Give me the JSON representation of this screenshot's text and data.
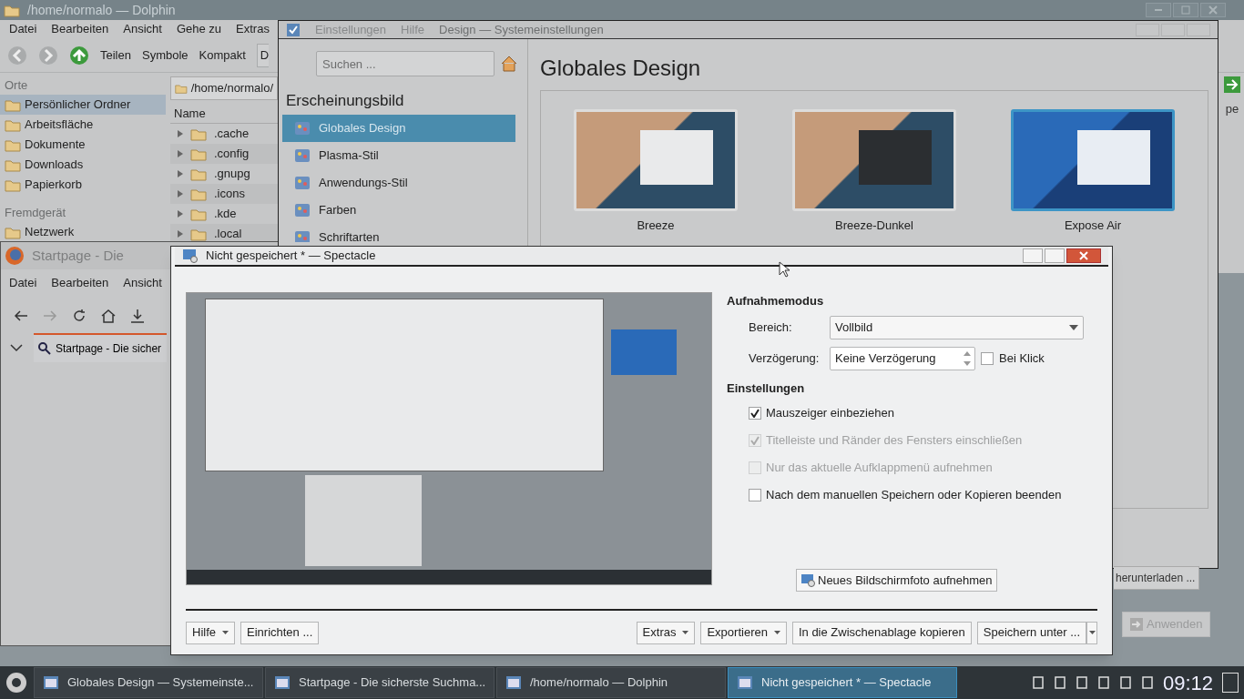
{
  "dolphin": {
    "title": "/home/normalo — Dolphin",
    "menu": [
      "Datei",
      "Bearbeiten",
      "Ansicht",
      "Gehe zu",
      "Extras"
    ],
    "toolbar": [
      "Teilen",
      "Symbole",
      "Kompakt",
      "D"
    ],
    "places_heading": "Orte",
    "places": [
      {
        "label": "Persönlicher Ordner",
        "selected": true
      },
      {
        "label": "Arbeitsfläche",
        "selected": false
      },
      {
        "label": "Dokumente",
        "selected": false
      },
      {
        "label": "Downloads",
        "selected": false
      },
      {
        "label": "Papierkorb",
        "selected": false
      }
    ],
    "remote_heading": "Fremdgerät",
    "remote": [
      "Netzwerk"
    ],
    "path": "/home/normalo/",
    "column": "Name",
    "column_fragment": "pe",
    "folders": [
      ".cache",
      ".config",
      ".gnupg",
      ".icons",
      ".kde",
      ".local"
    ]
  },
  "settings": {
    "menu": [
      "Einstellungen",
      "Hilfe"
    ],
    "title": "Design — Systemeinstellungen",
    "search_placeholder": "Suchen ...",
    "section": "Erscheinungsbild",
    "items": [
      {
        "label": "Globales Design",
        "selected": true
      },
      {
        "label": "Plasma-Stil",
        "selected": false
      },
      {
        "label": "Anwendungs-Stil",
        "selected": false
      },
      {
        "label": "Farben",
        "selected": false
      },
      {
        "label": "Schriftarten",
        "selected": false
      }
    ],
    "page_title": "Globales Design",
    "themes": [
      {
        "name": "Breeze",
        "kind": "light",
        "selected": false
      },
      {
        "name": "Breeze-Dunkel",
        "kind": "dark",
        "selected": false
      },
      {
        "name": "Expose Air",
        "kind": "blue",
        "selected": true
      }
    ],
    "download_button": "herunterladen ...",
    "apply_button": {
      "label": "Anwenden",
      "disabled": true
    }
  },
  "firefox": {
    "title": "Startpage - Die",
    "menu": [
      "Datei",
      "Bearbeiten",
      "Ansicht"
    ],
    "tab": "Startpage - Die sicher"
  },
  "spectacle": {
    "title": "Nicht gespeichert * — Spectacle",
    "mode_heading": "Aufnahmemodus",
    "area_label": "Bereich:",
    "area_value": "Vollbild",
    "delay_label": "Verzögerung:",
    "delay_value": "Keine Verzögerung",
    "on_click": {
      "label": "Bei Klick",
      "checked": false
    },
    "settings_heading": "Einstellungen",
    "options": [
      {
        "label": "Mauszeiger einbeziehen",
        "checked": true,
        "disabled": false
      },
      {
        "label": "Titelleiste und Ränder des Fensters einschließen",
        "checked": true,
        "disabled": true
      },
      {
        "label": "Nur das aktuelle Aufklappmenü aufnehmen",
        "checked": false,
        "disabled": true
      },
      {
        "label": "Nach dem manuellen Speichern oder Kopieren beenden",
        "checked": false,
        "disabled": false
      }
    ],
    "new_button": "Neues Bildschirmfoto aufnehmen",
    "footer_left": [
      {
        "label": "Hilfe",
        "kind": "menu"
      },
      {
        "label": "Einrichten ...",
        "kind": "plain"
      }
    ],
    "footer_right": [
      {
        "label": "Extras",
        "kind": "menu"
      },
      {
        "label": "Exportieren",
        "kind": "menu"
      },
      {
        "label": "In die Zwischenablage kopieren",
        "kind": "plain"
      },
      {
        "label": "Speichern unter ...",
        "kind": "split"
      }
    ]
  },
  "taskbar": {
    "tasks": [
      {
        "label": "Globales Design  — Systemeinste...",
        "selected": false
      },
      {
        "label": "Startpage - Die sicherste Suchma...",
        "selected": false
      },
      {
        "label": "/home/normalo — Dolphin",
        "selected": false
      },
      {
        "label": "Nicht gespeichert * — Spectacle",
        "selected": true
      }
    ],
    "clock": "09:12"
  }
}
